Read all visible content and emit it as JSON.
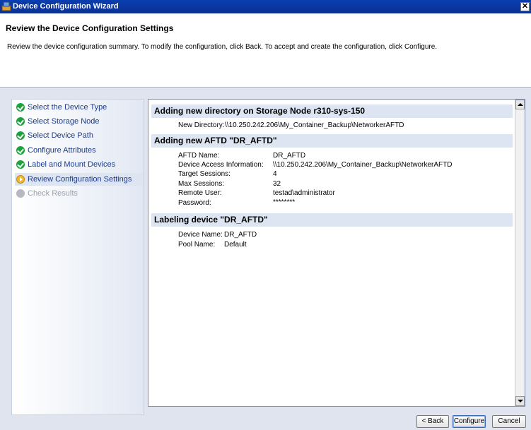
{
  "window": {
    "title": "Device Configuration Wizard",
    "icon": "wizard-app-icon",
    "close_label": "✕"
  },
  "header": {
    "title": "Review the Device Configuration Settings",
    "description": "Review the device configuration summary. To modify the configuration, click Back. To accept and create the configuration, click Configure."
  },
  "steps": [
    {
      "label": "Select the Device Type",
      "state": "done"
    },
    {
      "label": "Select Storage Node",
      "state": "done"
    },
    {
      "label": "Select Device Path",
      "state": "done"
    },
    {
      "label": "Configure Attributes",
      "state": "done"
    },
    {
      "label": "Label and Mount Devices",
      "state": "done"
    },
    {
      "label": "Review Configuration Settings",
      "state": "current"
    },
    {
      "label": "Check Results",
      "state": "pending"
    }
  ],
  "summary": {
    "section1": {
      "title": "Adding new directory on Storage Node r310-sys-150",
      "label": "New Directory:",
      "value": "\\\\10.250.242.206\\My_Container_Backup\\NetworkerAFTD"
    },
    "section2": {
      "title": "Adding new AFTD \"DR_AFTD\"",
      "rows": [
        {
          "label": "AFTD Name:",
          "value": "DR_AFTD"
        },
        {
          "label": "Device Access Information:",
          "value": "\\\\10.250.242.206\\My_Container_Backup\\NetworkerAFTD"
        },
        {
          "label": "Target Sessions:",
          "value": "4"
        },
        {
          "label": "Max Sessions:",
          "value": "32"
        },
        {
          "label": "Remote User:",
          "value": "testad\\administrator"
        },
        {
          "label": "Password:",
          "value": "********"
        }
      ]
    },
    "section3": {
      "title": "Labeling device \"DR_AFTD\"",
      "rows": [
        {
          "label": "Device Name:",
          "value": "DR_AFTD"
        },
        {
          "label": "Pool Name:",
          "value": "Default"
        }
      ]
    }
  },
  "buttons": {
    "back": "< Back",
    "configure": "Configure",
    "cancel": "Cancel"
  }
}
